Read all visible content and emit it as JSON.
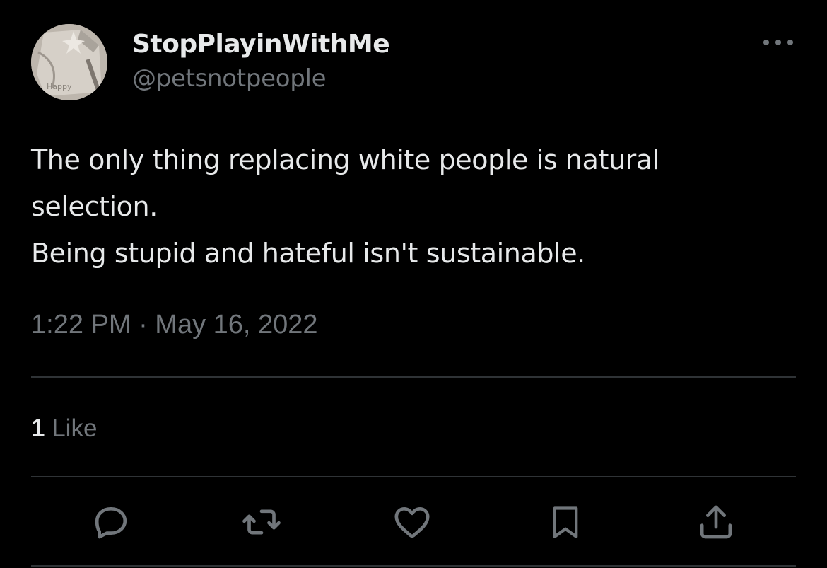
{
  "tweet": {
    "display_name": "StopPlayinWithMe",
    "handle": "@petsnotpeople",
    "avatar_text": "Happy",
    "text_lines": [
      "The only thing replacing white people is natural",
      "selection.",
      "Being stupid and hateful isn't sustainable."
    ],
    "timestamp": "1:22 PM · May 16, 2022",
    "likes_count": "1",
    "likes_label": "Like"
  },
  "icons": {
    "more": "more-horizontal-icon",
    "reply": "reply-icon",
    "retweet": "retweet-icon",
    "like": "heart-icon",
    "bookmark": "bookmark-icon",
    "share": "share-icon"
  },
  "colors": {
    "background": "#000000",
    "primary_text": "#e7e9ea",
    "secondary_text": "#71767b",
    "divider": "#2f3336"
  }
}
